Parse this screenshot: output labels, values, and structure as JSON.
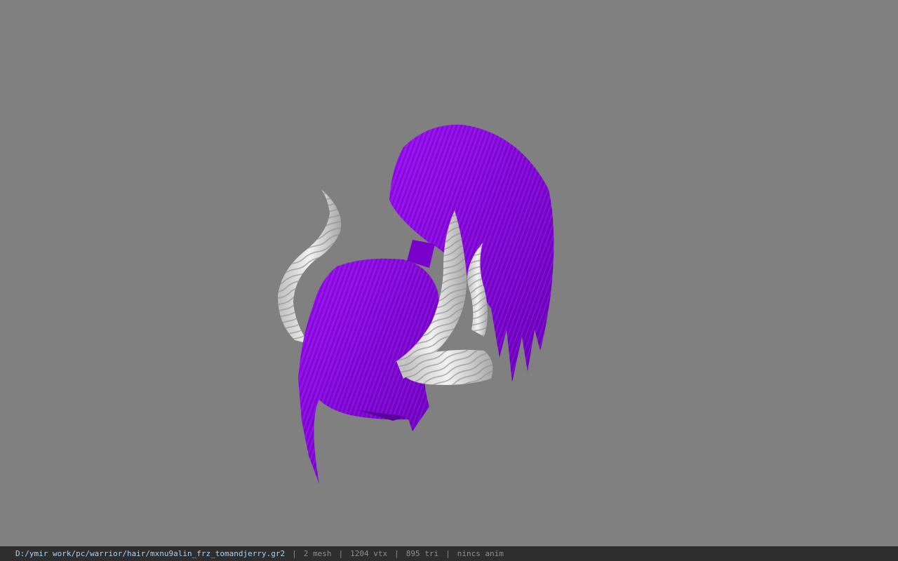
{
  "viewport": {
    "background": "#808080",
    "model": {
      "hair_color": "#8a00e6",
      "horn_color": "#d9d9d9"
    }
  },
  "status": {
    "file_path": "D:/ymir work/pc/warrior/hair/mxnu9alin_frz_tomandjerry.gr2",
    "separator": "|",
    "mesh": "2 mesh",
    "vertices": "1204 vtx",
    "triangles": "895 tri",
    "anim": "nincs anim"
  }
}
